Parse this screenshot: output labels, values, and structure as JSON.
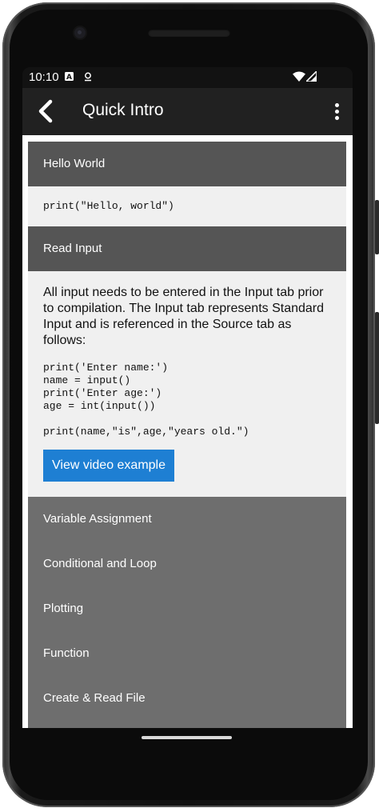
{
  "status_bar": {
    "time": "10:10",
    "icons": [
      "notification-a-icon",
      "location-icon",
      "wifi-icon",
      "signal-icon"
    ]
  },
  "app_bar": {
    "title": "Quick Intro",
    "back_icon": "chevron-left-icon",
    "menu_icon": "more-vertical-icon"
  },
  "sections": {
    "hello_world": {
      "title": "Hello World",
      "code": "print(\"Hello, world\")"
    },
    "read_input": {
      "title": "Read Input",
      "description": "All input needs to be entered in the Input tab prior to compilation. The Input tab represents Standard Input and is referenced in the Source tab as follows:",
      "code": "print('Enter name:')\nname = input()\nprint('Enter age:')\nage = int(input())\n\nprint(name,\"is\",age,\"years old.\")",
      "button_label": "View video example"
    },
    "collapsed": [
      {
        "title": "Variable Assignment"
      },
      {
        "title": "Conditional and Loop"
      },
      {
        "title": "Plotting"
      },
      {
        "title": "Function"
      },
      {
        "title": "Create & Read File"
      }
    ]
  },
  "colors": {
    "header": "#555555",
    "collapsed": "#6e6e6e",
    "panel": "#f0f0f0",
    "button": "#1e7fd3",
    "appbar": "#212121"
  }
}
